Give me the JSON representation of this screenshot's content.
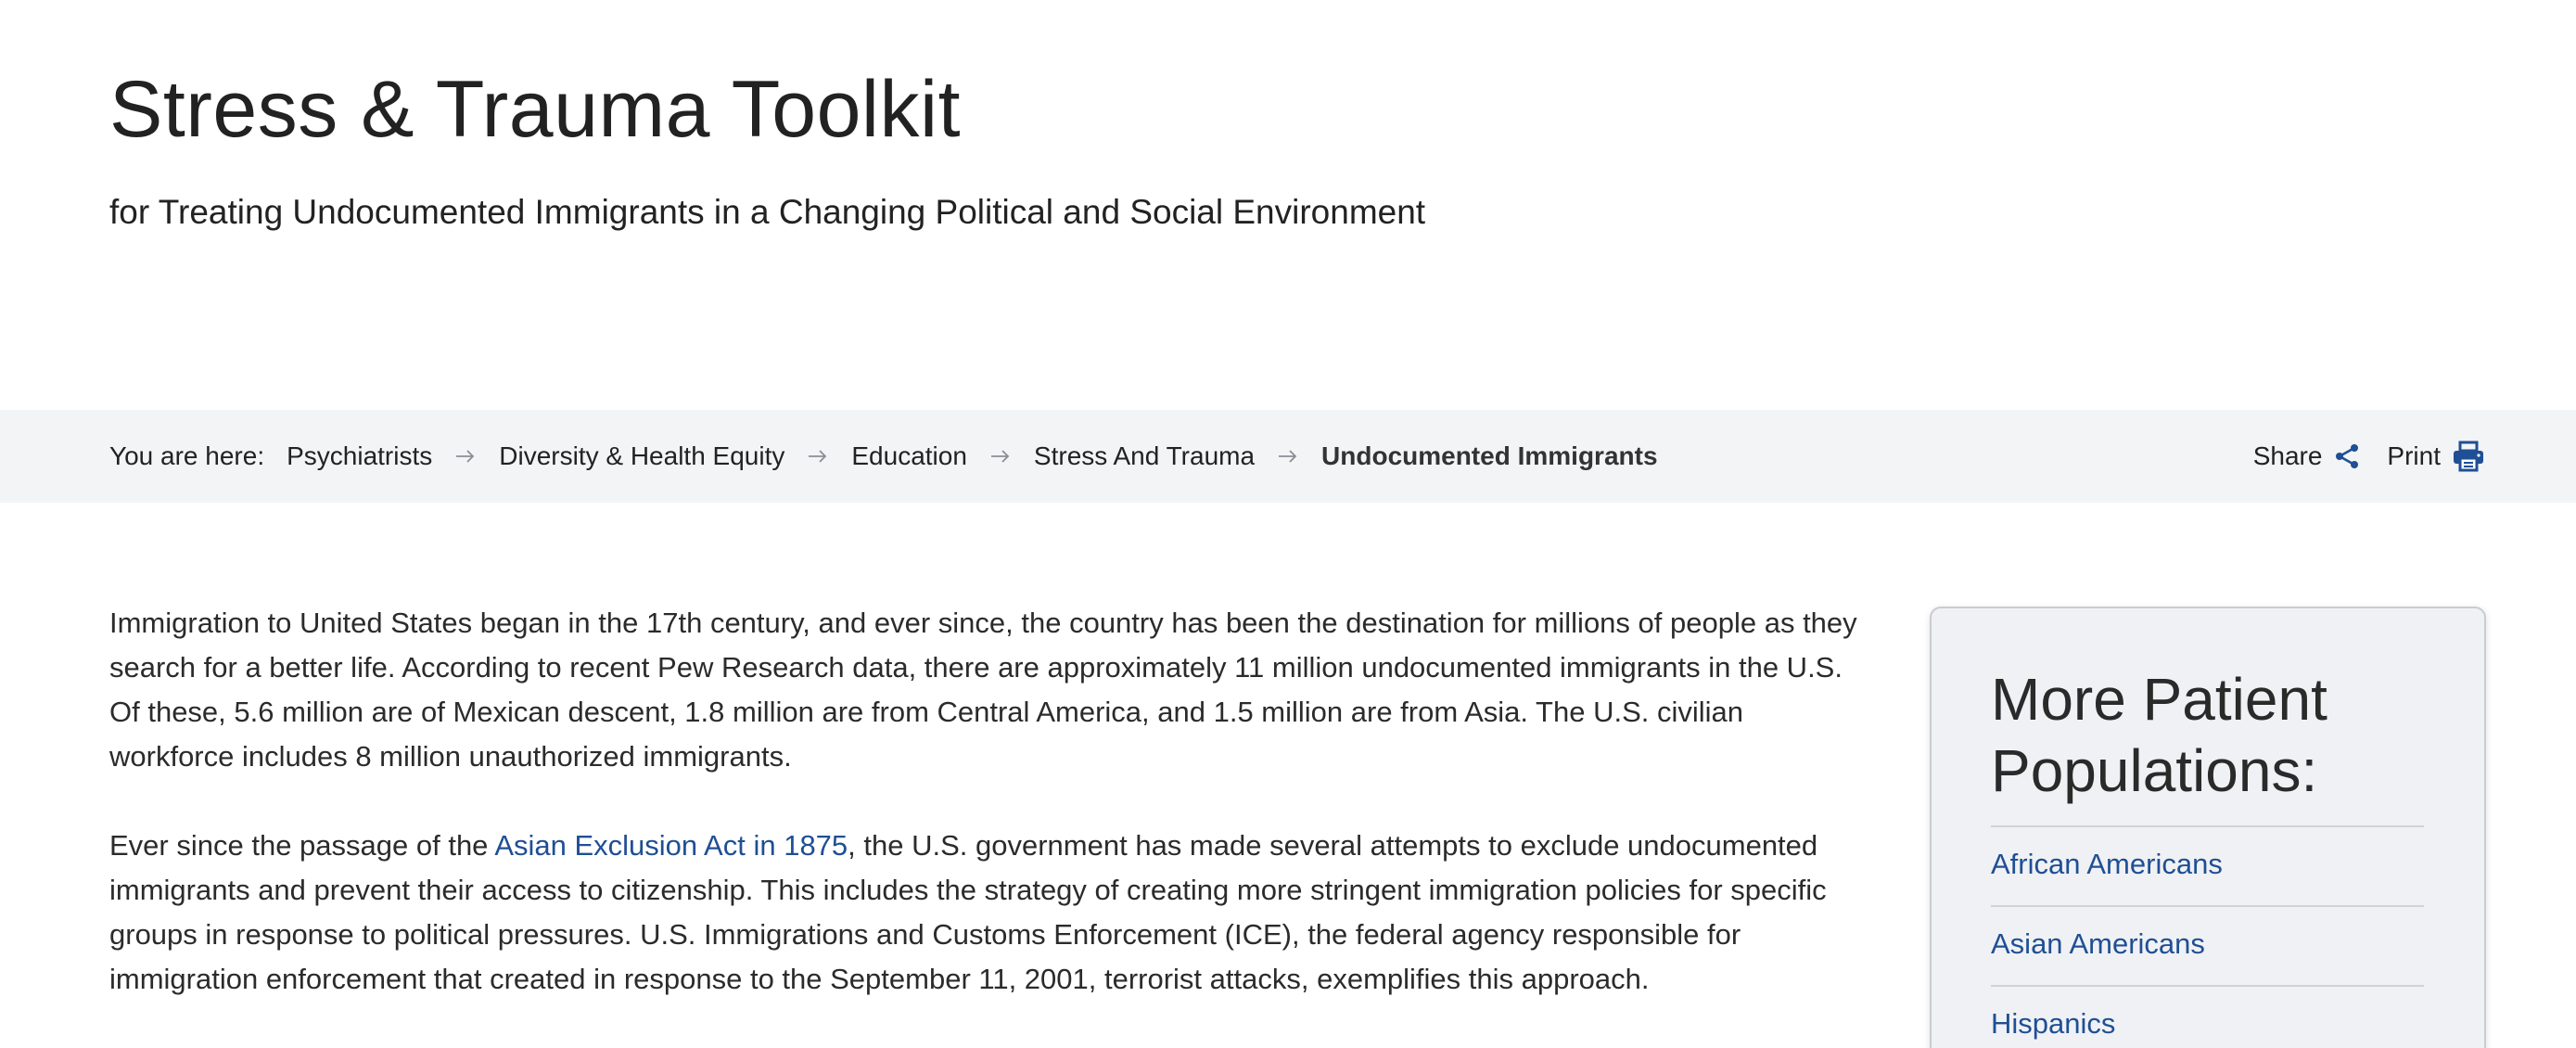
{
  "header": {
    "title": "Stress & Trauma Toolkit",
    "subtitle": "for Treating Undocumented Immigrants in a Changing Political and Social Environment"
  },
  "breadcrumb": {
    "prefix": "You are here:",
    "items": [
      {
        "label": "Psychiatrists"
      },
      {
        "label": "Diversity & Health Equity"
      },
      {
        "label": "Education"
      },
      {
        "label": "Stress And Trauma"
      },
      {
        "label": "Undocumented Immigrants"
      }
    ],
    "separator_icon": "arrow-right-icon"
  },
  "actions": {
    "share_label": "Share",
    "share_icon": "share-icon",
    "print_label": "Print",
    "print_icon": "printer-icon"
  },
  "content": {
    "para1": "Immigration to United States began in the 17th century, and ever since, the country has been the destination for millions of people as they search for a better life. According to recent Pew Research data, there are approximately 11 million undocumented immigrants in the U.S. Of these, 5.6 million are of Mexican descent, 1.8 million are from Central America, and 1.5 million are from Asia. The U.S. civilian workforce includes 8 million unauthorized immigrants.",
    "para2_before": "Ever since the passage of the ",
    "para2_link": "Asian Exclusion Act in 1875",
    "para2_after": ", the U.S. government has made several attempts to exclude undocumented immigrants and prevent their access to citizenship. This includes the strategy of creating more stringent immigration policies for specific groups in response to political pressures. U.S. Immigrations and Customs Enforcement (ICE), the federal agency responsible for immigration enforcement that created in response to the September 11, 2001, terrorist attacks, exemplifies this approach."
  },
  "sidebar": {
    "title": "More Patient Populations:",
    "links": [
      {
        "label": "African Americans"
      },
      {
        "label": "Asian Americans"
      },
      {
        "label": "Hispanics"
      }
    ]
  },
  "colors": {
    "link": "#1f4f94",
    "breadcrumb_bg": "#f3f4f6",
    "card_bg": "#f0f1f4",
    "text": "#212121"
  }
}
